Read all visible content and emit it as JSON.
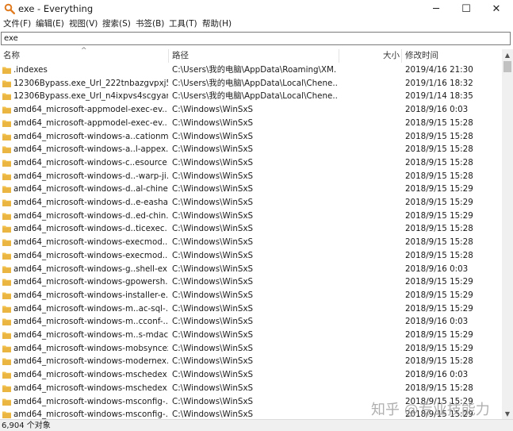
{
  "window": {
    "title": "exe - Everything",
    "minimize_glyph": "─",
    "maximize_glyph": "☐",
    "close_glyph": "✕",
    "app_icon": "magnifier-icon"
  },
  "menu": [
    "文件(F)",
    "编辑(E)",
    "视图(V)",
    "搜索(S)",
    "书签(B)",
    "工具(T)",
    "帮助(H)"
  ],
  "search": {
    "value": "exe"
  },
  "columns": {
    "name": "名称",
    "path": "路径",
    "size": "大小",
    "modified": "修改时间"
  },
  "rows": [
    {
      "name": ".indexes",
      "path": "C:\\Users\\我的电脑\\AppData\\Roaming\\XM...",
      "modified": "2019/4/16 21:30"
    },
    {
      "name": "12306Bypass.exe_Url_222tnbazgvpxj5...",
      "path": "C:\\Users\\我的电脑\\AppData\\Local\\Chene...",
      "modified": "2019/1/16 18:32"
    },
    {
      "name": "12306Bypass.exe_Url_n4ixpvs4scgyan...",
      "path": "C:\\Users\\我的电脑\\AppData\\Local\\Chene...",
      "modified": "2019/1/14 18:35"
    },
    {
      "name": "amd64_microsoft-appmodel-exec-ev...",
      "path": "C:\\Windows\\WinSxS",
      "modified": "2018/9/16 0:03"
    },
    {
      "name": "amd64_microsoft-appmodel-exec-ev...",
      "path": "C:\\Windows\\WinSxS",
      "modified": "2018/9/15 15:28"
    },
    {
      "name": "amd64_microsoft-windows-a..cationm...",
      "path": "C:\\Windows\\WinSxS",
      "modified": "2018/9/15 15:28"
    },
    {
      "name": "amd64_microsoft-windows-a..l-appex...",
      "path": "C:\\Windows\\WinSxS",
      "modified": "2018/9/15 15:28"
    },
    {
      "name": "amd64_microsoft-windows-c..esource...",
      "path": "C:\\Windows\\WinSxS",
      "modified": "2018/9/15 15:28"
    },
    {
      "name": "amd64_microsoft-windows-d..-warp-ji...",
      "path": "C:\\Windows\\WinSxS",
      "modified": "2018/9/15 15:28"
    },
    {
      "name": "amd64_microsoft-windows-d..al-chine...",
      "path": "C:\\Windows\\WinSxS",
      "modified": "2018/9/15 15:29"
    },
    {
      "name": "amd64_microsoft-windows-d..e-easha...",
      "path": "C:\\Windows\\WinSxS",
      "modified": "2018/9/15 15:29"
    },
    {
      "name": "amd64_microsoft-windows-d..ed-chin...",
      "path": "C:\\Windows\\WinSxS",
      "modified": "2018/9/15 15:29"
    },
    {
      "name": "amd64_microsoft-windows-d..ticexec...",
      "path": "C:\\Windows\\WinSxS",
      "modified": "2018/9/15 15:28"
    },
    {
      "name": "amd64_microsoft-windows-execmod...",
      "path": "C:\\Windows\\WinSxS",
      "modified": "2018/9/15 15:28"
    },
    {
      "name": "amd64_microsoft-windows-execmod...",
      "path": "C:\\Windows\\WinSxS",
      "modified": "2018/9/15 15:28"
    },
    {
      "name": "amd64_microsoft-windows-g..shell-ex...",
      "path": "C:\\Windows\\WinSxS",
      "modified": "2018/9/16 0:03"
    },
    {
      "name": "amd64_microsoft-windows-gpowersh...",
      "path": "C:\\Windows\\WinSxS",
      "modified": "2018/9/15 15:29"
    },
    {
      "name": "amd64_microsoft-windows-installer-e...",
      "path": "C:\\Windows\\WinSxS",
      "modified": "2018/9/15 15:29"
    },
    {
      "name": "amd64_microsoft-windows-m..ac-sql-...",
      "path": "C:\\Windows\\WinSxS",
      "modified": "2018/9/15 15:29"
    },
    {
      "name": "amd64_microsoft-windows-m..cconf-...",
      "path": "C:\\Windows\\WinSxS",
      "modified": "2018/9/16 0:03"
    },
    {
      "name": "amd64_microsoft-windows-m..s-mdac...",
      "path": "C:\\Windows\\WinSxS",
      "modified": "2018/9/15 15:29"
    },
    {
      "name": "amd64_microsoft-windows-mobsyncex...",
      "path": "C:\\Windows\\WinSxS",
      "modified": "2018/9/15 15:29"
    },
    {
      "name": "amd64_microsoft-windows-modernex...",
      "path": "C:\\Windows\\WinSxS",
      "modified": "2018/9/15 15:28"
    },
    {
      "name": "amd64_microsoft-windows-mschedex...",
      "path": "C:\\Windows\\WinSxS",
      "modified": "2018/9/16 0:03"
    },
    {
      "name": "amd64_microsoft-windows-mschedex...",
      "path": "C:\\Windows\\WinSxS",
      "modified": "2018/9/15 15:28"
    },
    {
      "name": "amd64_microsoft-windows-msconfig-...",
      "path": "C:\\Windows\\WinSxS",
      "modified": "2018/9/15 15:29"
    },
    {
      "name": "amd64_microsoft-windows-msconfig-...",
      "path": "C:\\Windows\\WinSxS",
      "modified": "2018/9/15 15:29"
    }
  ],
  "status": {
    "count": "6,904 个对象"
  },
  "watermark": "知乎 @专业技能力",
  "colors": {
    "folder": "#f2c14e",
    "folder_dark": "#dca42a",
    "scrollbar": "#f0f0f0"
  }
}
